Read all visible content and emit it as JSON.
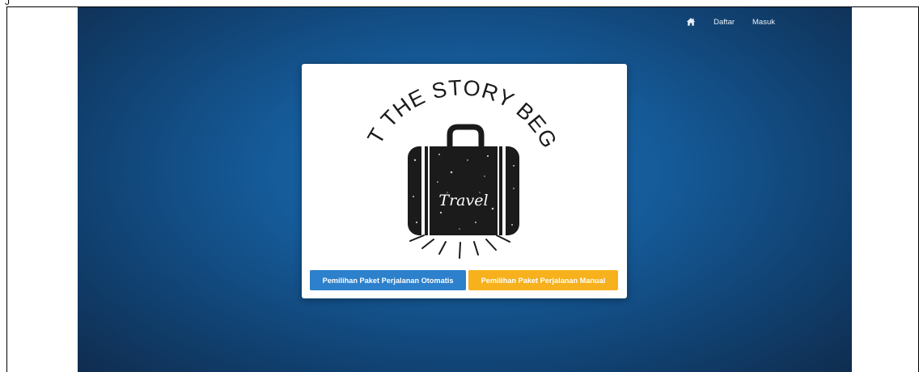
{
  "header_fragment": "J",
  "nav": {
    "home_icon": "home-icon",
    "daftar": "Daftar",
    "masuk": "Masuk"
  },
  "logo": {
    "headline": "LET THE STORY BEGIN",
    "bag_label": "Travel"
  },
  "buttons": {
    "auto": "Pemilihan Paket Perjalanan Otomatis",
    "manual": "Pemilihan Paket Perjalanan Manual"
  },
  "colors": {
    "auto_button": "#2c80cc",
    "manual_button": "#f6b11c",
    "background_center": "#1c6eb4",
    "background_edge": "#0f2746"
  }
}
